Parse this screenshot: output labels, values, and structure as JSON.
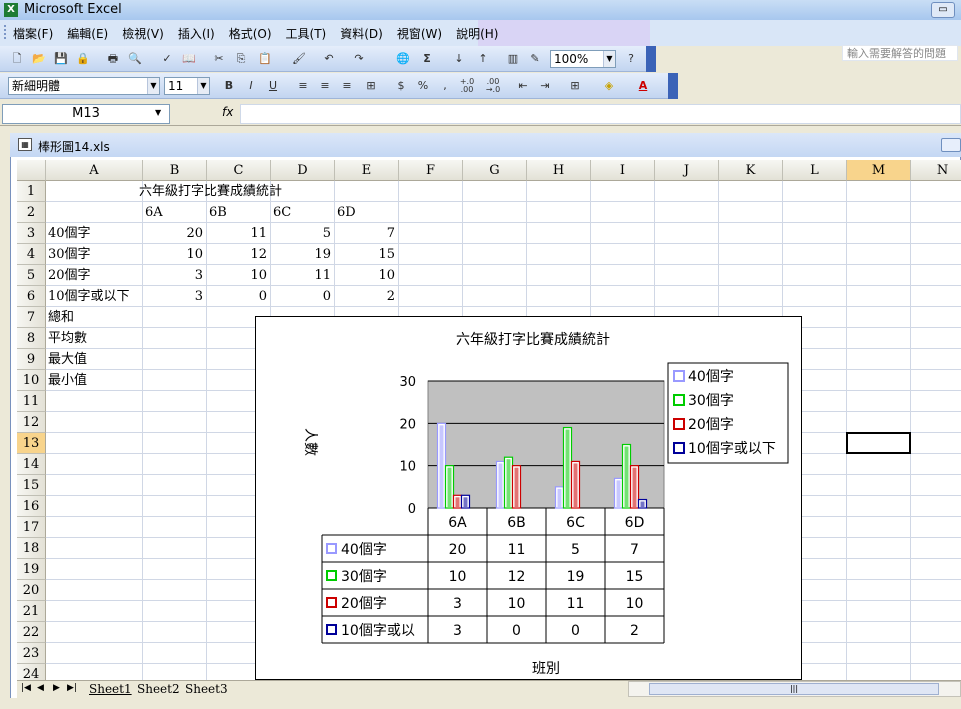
{
  "app": {
    "title": "Microsoft Excel"
  },
  "menu": {
    "items": [
      "檔案(F)",
      "編輯(E)",
      "檢視(V)",
      "插入(I)",
      "格式(O)",
      "工具(T)",
      "資料(D)",
      "視窗(W)",
      "說明(H)"
    ],
    "help_placeholder": "輸入需要解答的問題"
  },
  "toolbar": {
    "zoom": "100%",
    "font_name": "新細明體",
    "font_size": "11",
    "bold": "B",
    "italic": "I",
    "underline": "U",
    "percent": "%",
    "comma": ",",
    "inc_decimal": "+.0\n.00",
    "dec_decimal": ".00\n+.0"
  },
  "formula_bar": {
    "name_box": "M13",
    "fx": "fx",
    "value": ""
  },
  "workbook": {
    "title": "棒形圖14.xls"
  },
  "grid": {
    "columns": [
      "A",
      "B",
      "C",
      "D",
      "E",
      "F",
      "G",
      "H",
      "I",
      "J",
      "K",
      "L",
      "M",
      "N"
    ],
    "rows": [
      "1",
      "2",
      "3",
      "4",
      "5",
      "6",
      "7",
      "8",
      "9",
      "10",
      "11",
      "12",
      "13",
      "14",
      "15",
      "16",
      "17",
      "18",
      "19",
      "20",
      "21",
      "22",
      "23",
      "24"
    ],
    "selected_column": "M",
    "selected_row": "13",
    "title_cell": "六年級打字比賽成績統計",
    "class_headers": [
      "6A",
      "6B",
      "6C",
      "6D"
    ],
    "data_rows": [
      {
        "label": "40個字",
        "values": [
          "20",
          "11",
          "5",
          "7"
        ]
      },
      {
        "label": "30個字",
        "values": [
          "10",
          "12",
          "19",
          "15"
        ]
      },
      {
        "label": "20個字",
        "values": [
          "3",
          "10",
          "11",
          "10"
        ]
      },
      {
        "label": "10個字或以下",
        "values": [
          "3",
          "0",
          "0",
          "2"
        ]
      }
    ],
    "stat_labels": [
      "總和",
      "平均數",
      "最大值",
      "最小值"
    ]
  },
  "chart_data": {
    "type": "bar",
    "title": "六年級打字比賽成績統計",
    "xlabel": "班別",
    "ylabel": "人數",
    "categories": [
      "6A",
      "6B",
      "6C",
      "6D"
    ],
    "ylim": [
      0,
      30
    ],
    "yticks": [
      "0",
      "10",
      "20",
      "30"
    ],
    "series": [
      {
        "name": "40個字",
        "values": [
          20,
          11,
          5,
          7
        ],
        "color": "#9999ff"
      },
      {
        "name": "30個字",
        "values": [
          10,
          12,
          19,
          15
        ],
        "color": "#00cc00"
      },
      {
        "name": "20個字",
        "values": [
          3,
          10,
          11,
          10
        ],
        "color": "#cc0000"
      },
      {
        "name": "10個字或以下",
        "values": [
          3,
          0,
          0,
          2
        ],
        "color": "#000099"
      }
    ],
    "table_labels": [
      "40個字",
      "30個字",
      "20個字",
      "10個字或以"
    ],
    "legend_position": "right",
    "plot_background": "#c0c0c0",
    "grid": true
  },
  "sheets": {
    "tabs": [
      "Sheet1",
      "Sheet2",
      "Sheet3"
    ],
    "active": "Sheet1"
  }
}
